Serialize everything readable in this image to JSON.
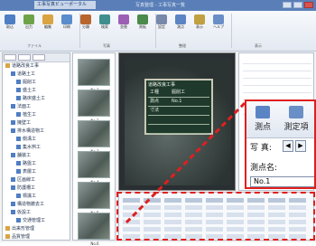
{
  "window": {
    "app_badge": "工事写真ビューポータル",
    "doc_title": "写真整理 - 工事写真一覧"
  },
  "ribbon": {
    "tools": [
      {
        "label": "取込",
        "color": "#4f7ec4"
      },
      {
        "label": "出力",
        "color": "#6fa34a"
      },
      {
        "label": "編集",
        "color": "#d9a441"
      },
      {
        "label": "印刷",
        "color": "#5b8ccc"
      },
      {
        "label": "分類",
        "color": "#b9652e"
      },
      {
        "label": "検索",
        "color": "#3f8f8f"
      },
      {
        "label": "並替",
        "color": "#9c5fb3"
      },
      {
        "label": "黒板",
        "color": "#4a8a4a"
      },
      {
        "label": "設定",
        "color": "#7788aa"
      },
      {
        "label": "測点",
        "color": "#5b84c4"
      },
      {
        "label": "表示",
        "color": "#c0a040"
      },
      {
        "label": "ヘルプ",
        "color": "#6a8fc7"
      }
    ],
    "groups": [
      "ファイル",
      "写真",
      "整理",
      "表示"
    ]
  },
  "tree": {
    "items": [
      {
        "label": "道路改良工事",
        "color": "#d9a441",
        "indent": 0
      },
      {
        "label": "道路土工",
        "color": "#4f7ec4",
        "indent": 1
      },
      {
        "label": "掘削工",
        "color": "#4f7ec4",
        "indent": 2
      },
      {
        "label": "盛土工",
        "color": "#4f7ec4",
        "indent": 2
      },
      {
        "label": "路床盛土工",
        "color": "#4f7ec4",
        "indent": 2
      },
      {
        "label": "法面工",
        "color": "#4f7ec4",
        "indent": 1
      },
      {
        "label": "植生工",
        "color": "#4f7ec4",
        "indent": 2
      },
      {
        "label": "擁壁工",
        "color": "#4f7ec4",
        "indent": 1
      },
      {
        "label": "排水構造物工",
        "color": "#4f7ec4",
        "indent": 1
      },
      {
        "label": "側溝工",
        "color": "#4f7ec4",
        "indent": 2
      },
      {
        "label": "集水桝工",
        "color": "#4f7ec4",
        "indent": 2
      },
      {
        "label": "舗装工",
        "color": "#4f7ec4",
        "indent": 1
      },
      {
        "label": "路盤工",
        "color": "#4f7ec4",
        "indent": 2
      },
      {
        "label": "表層工",
        "color": "#4f7ec4",
        "indent": 2
      },
      {
        "label": "区画線工",
        "color": "#4f7ec4",
        "indent": 1
      },
      {
        "label": "防護柵工",
        "color": "#4f7ec4",
        "indent": 1
      },
      {
        "label": "標識工",
        "color": "#4f7ec4",
        "indent": 2
      },
      {
        "label": "構造物撤去工",
        "color": "#4f7ec4",
        "indent": 1
      },
      {
        "label": "仮設工",
        "color": "#4f7ec4",
        "indent": 1
      },
      {
        "label": "交通管理工",
        "color": "#4f7ec4",
        "indent": 2
      },
      {
        "label": "出来形管理",
        "color": "#d9a441",
        "indent": 0
      },
      {
        "label": "品質管理",
        "color": "#d9a441",
        "indent": 0
      }
    ]
  },
  "thumbnails": [
    {
      "caption": "No.1"
    },
    {
      "caption": "No.2"
    },
    {
      "caption": "No.3"
    },
    {
      "caption": "No.4"
    },
    {
      "caption": "No.5"
    },
    {
      "caption": "No.6"
    }
  ],
  "blackboard": {
    "title": "道路改良工事",
    "rows": [
      {
        "key": "工種",
        "value": "掘削工"
      },
      {
        "key": "測点",
        "value": "No.1"
      },
      {
        "key": "寸法",
        "value": ""
      },
      {
        "key": "",
        "value": ""
      },
      {
        "key": "",
        "value": ""
      }
    ]
  },
  "zoom": {
    "btn1_label": "測点",
    "btn2_label": "測定項",
    "photo_label": "写 真:",
    "station_label": "測点名:",
    "station_value": "No.1"
  }
}
